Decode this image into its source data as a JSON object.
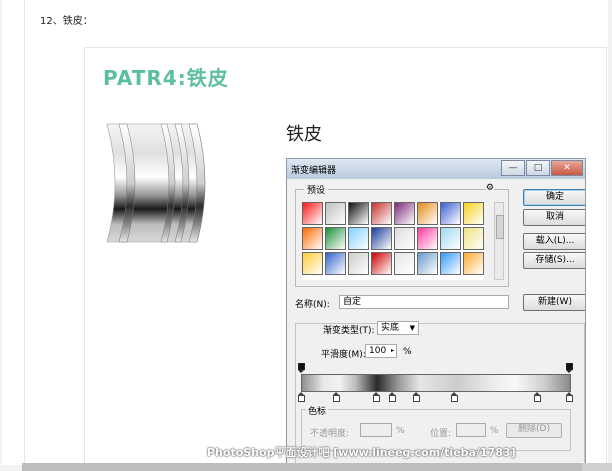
{
  "document": {
    "caption": "12、铁皮：",
    "slide_title": "PATR4:铁皮",
    "heading": "铁皮"
  },
  "dialog": {
    "title": "渐变编辑器",
    "window_buttons": [
      "—",
      "□",
      "✕"
    ],
    "preset_label": "预设",
    "preset_menu_icon": "gear-icon",
    "buttons": {
      "ok": "确定",
      "cancel": "取消",
      "load": "载入(L)...",
      "save": "存储(S)...",
      "new": "新建(W)"
    },
    "name_label": "名称(N):",
    "name_value": "自定",
    "gradient_type_label": "渐变类型(T):",
    "gradient_type_value": "实底",
    "smoothness_label": "平滑度(M):",
    "smoothness_value": "100",
    "smoothness_unit": "%",
    "color_stops_label": "色标",
    "opacity_label": "不透明度:",
    "opacity_unit": "%",
    "location_label": "位置:",
    "location_unit": "%",
    "delete_label": "删除(D)",
    "swatch_colors": [
      "#ff1a1a",
      "#bfbfbf",
      "#111111",
      "#c4302b",
      "#7b2a7a",
      "#e58a1a",
      "#3a5fd4",
      "#f4d21a",
      "#ff6a00",
      "#1e8f3a",
      "#7fd1ff",
      "#1a3a9a",
      "#dcdcdc",
      "#ff3aa0",
      "#a0d8f0",
      "#f0e080",
      "#ffcc33",
      "#3366cc",
      "#cccccc",
      "#cc0000",
      "#e6e6e6",
      "#6699cc",
      "#3399ff",
      "#ffaa33"
    ],
    "color_stop_positions": [
      0,
      13,
      28,
      34,
      43,
      57,
      88,
      100
    ],
    "opacity_stop_positions": [
      0,
      100
    ]
  },
  "watermark": "PhotoShop平面设计吧  [www.lineeg.com/tieba/1783]"
}
